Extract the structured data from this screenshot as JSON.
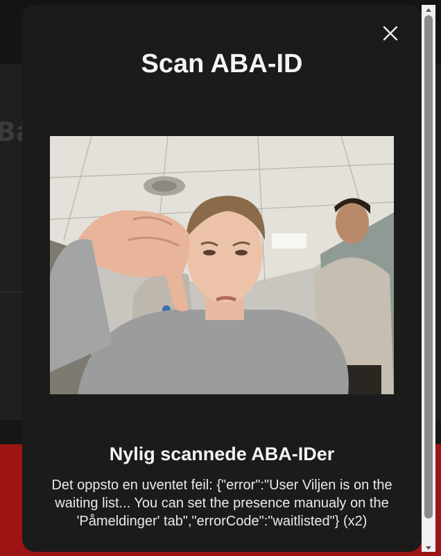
{
  "backdrop": {
    "title": "Ba"
  },
  "modal": {
    "title": "Scan ABA-ID",
    "close_icon": "close-icon",
    "camera_feed": "camera-feed-image",
    "recent_title": "Nylig scannede ABA-IDer",
    "error_message": "Det oppsto en uventet feil: {\"error\":\"User Viljen is on the waiting list... You can set the presence manualy on the 'Påmeldinger' tab\",\"errorCode\":\"waitlisted\"} (x2)"
  },
  "colors": {
    "modal_bg": "#1b1b1b",
    "text": "#f4f4f4",
    "accent_red": "#9c1414"
  }
}
